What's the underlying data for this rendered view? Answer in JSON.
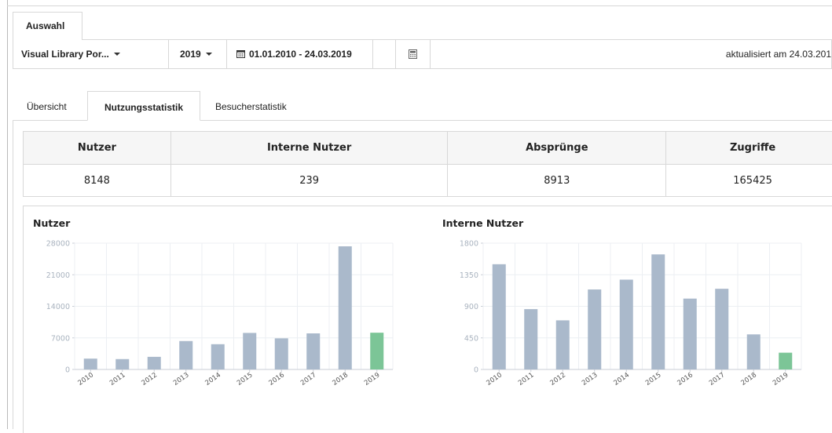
{
  "selection": {
    "tab_label": "Auswahl",
    "portal": "Visual Library Por...",
    "year": "2019",
    "date_range": "01.01.2010 - 24.03.2019",
    "updated": "aktualisiert am 24.03.201"
  },
  "subtabs": [
    {
      "label": "Übersicht",
      "active": false
    },
    {
      "label": "Nutzungsstatistik",
      "active": true
    },
    {
      "label": "Besucherstatistik",
      "active": false
    }
  ],
  "stats": {
    "headers": [
      "Nutzer",
      "Interne Nutzer",
      "Absprünge",
      "Zugriffe"
    ],
    "values": [
      "8148",
      "239",
      "8913",
      "165425"
    ]
  },
  "colors": {
    "bar": "#aab9cb",
    "highlight": "#7cc597",
    "grid": "#eceff3",
    "axis_text": "#a9b3bf"
  },
  "chart_data": [
    {
      "type": "bar",
      "title": "Nutzer",
      "categories": [
        "2010",
        "2011",
        "2012",
        "2013",
        "2014",
        "2015",
        "2016",
        "2017",
        "2018",
        "2019"
      ],
      "values": [
        2400,
        2300,
        2800,
        6300,
        5600,
        8100,
        6900,
        8000,
        27300,
        8148
      ],
      "ylim": [
        0,
        28000
      ],
      "yticks": [
        "0",
        "7000",
        "14000",
        "21000",
        "28000"
      ],
      "highlight": "2019",
      "grid": true
    },
    {
      "type": "bar",
      "title": "Interne Nutzer",
      "categories": [
        "2010",
        "2011",
        "2012",
        "2013",
        "2014",
        "2015",
        "2016",
        "2017",
        "2018",
        "2019"
      ],
      "values": [
        1500,
        860,
        700,
        1140,
        1280,
        1640,
        1010,
        1150,
        500,
        239
      ],
      "ylim": [
        0,
        1800
      ],
      "yticks": [
        "0",
        "450",
        "900",
        "1350",
        "1800"
      ],
      "highlight": "2019",
      "grid": true
    }
  ]
}
